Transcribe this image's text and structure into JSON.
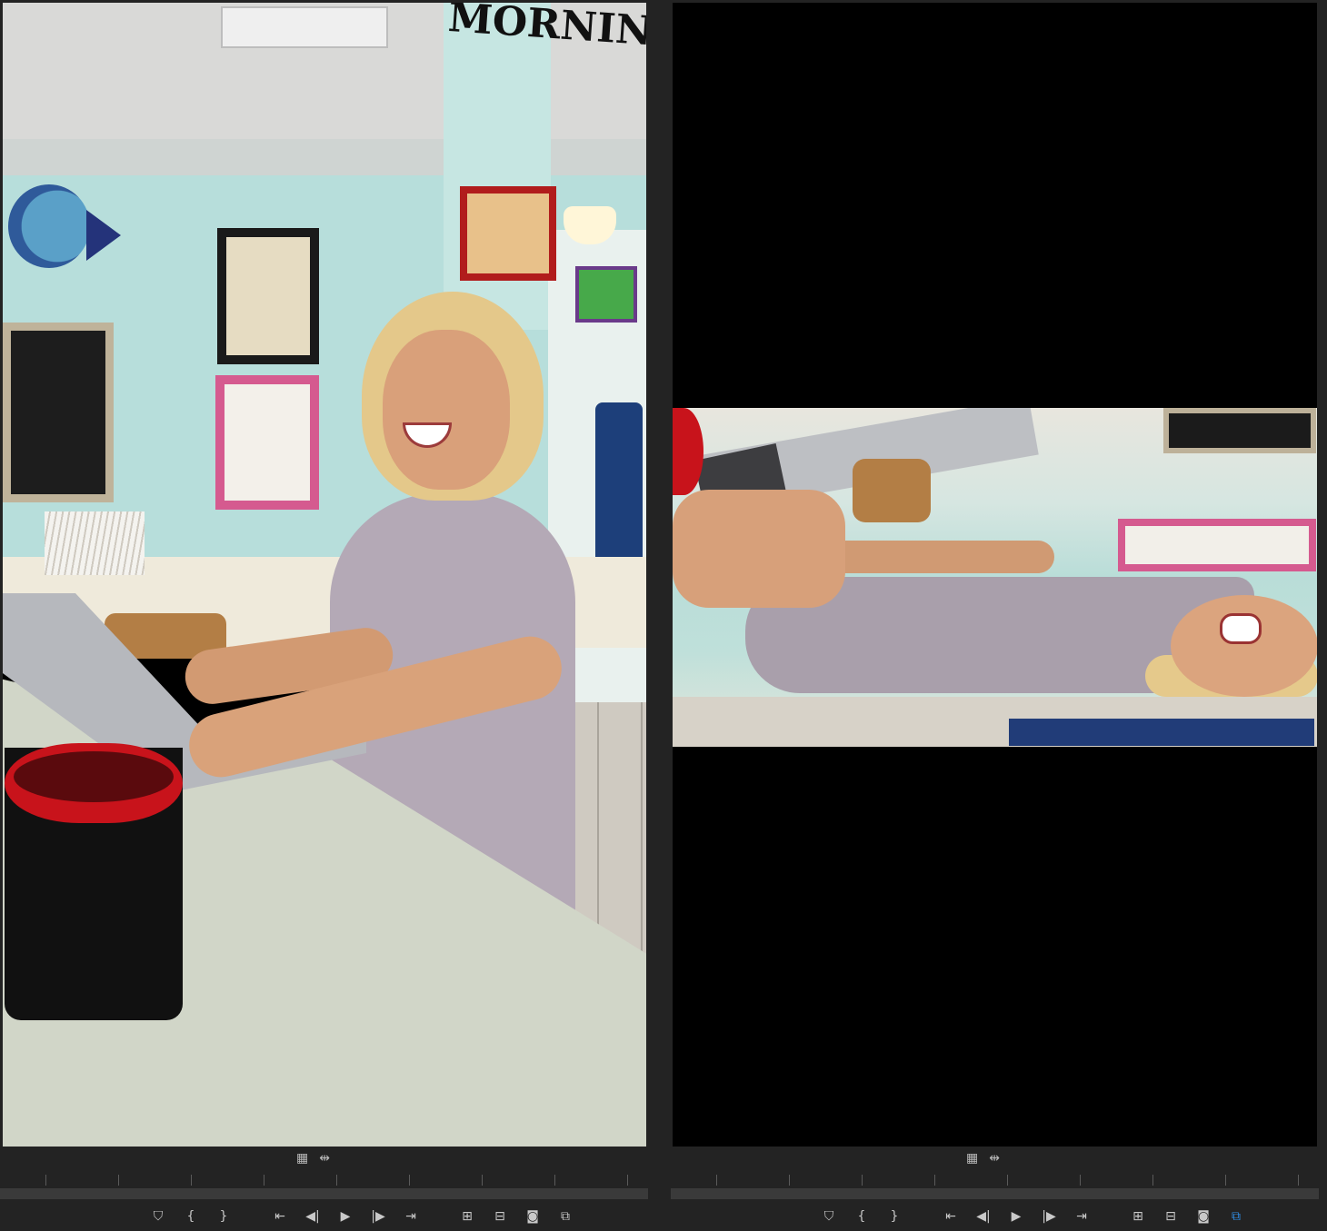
{
  "source_monitor": {
    "frame_sign_text": "MORNING",
    "settings": [
      {
        "icon": "film-settings-icon"
      },
      {
        "icon": "drag-audio-video-icon"
      }
    ],
    "transport": [
      {
        "icon": "add-marker-icon",
        "glyph": "⛉"
      },
      {
        "icon": "mark-in-icon",
        "glyph": "{"
      },
      {
        "icon": "mark-out-icon",
        "glyph": "}"
      },
      {
        "icon": "go-to-in-icon",
        "glyph": "⇤"
      },
      {
        "icon": "step-back-icon",
        "glyph": "◀|"
      },
      {
        "icon": "play-icon",
        "glyph": "▶"
      },
      {
        "icon": "step-forward-icon",
        "glyph": "|▶"
      },
      {
        "icon": "go-to-out-icon",
        "glyph": "⇥"
      },
      {
        "icon": "insert-icon",
        "glyph": "⊞"
      },
      {
        "icon": "overwrite-icon",
        "glyph": "⊟"
      },
      {
        "icon": "export-frame-icon",
        "glyph": "◙"
      },
      {
        "icon": "button-editor-icon",
        "glyph": "⧉"
      }
    ]
  },
  "program_monitor": {
    "settings": [
      {
        "icon": "film-settings-icon"
      },
      {
        "icon": "drag-audio-video-icon"
      }
    ],
    "transport": [
      {
        "icon": "add-marker-icon",
        "glyph": "⛉"
      },
      {
        "icon": "mark-in-icon",
        "glyph": "{"
      },
      {
        "icon": "mark-out-icon",
        "glyph": "}"
      },
      {
        "icon": "go-to-in-icon",
        "glyph": "⇤"
      },
      {
        "icon": "step-back-icon",
        "glyph": "◀|"
      },
      {
        "icon": "play-icon",
        "glyph": "▶"
      },
      {
        "icon": "step-forward-icon",
        "glyph": "|▶"
      },
      {
        "icon": "go-to-out-icon",
        "glyph": "⇥"
      },
      {
        "icon": "lift-icon",
        "glyph": "⊞"
      },
      {
        "icon": "extract-icon",
        "glyph": "⊟"
      },
      {
        "icon": "export-frame-icon",
        "glyph": "◙"
      },
      {
        "icon": "comparison-view-icon",
        "glyph": "⧉",
        "active": true
      }
    ]
  },
  "colors": {
    "panel_bg": "#232323",
    "viewer_bg": "#000000",
    "icon": "#c9c9c9",
    "active_icon": "#2f8de4"
  }
}
